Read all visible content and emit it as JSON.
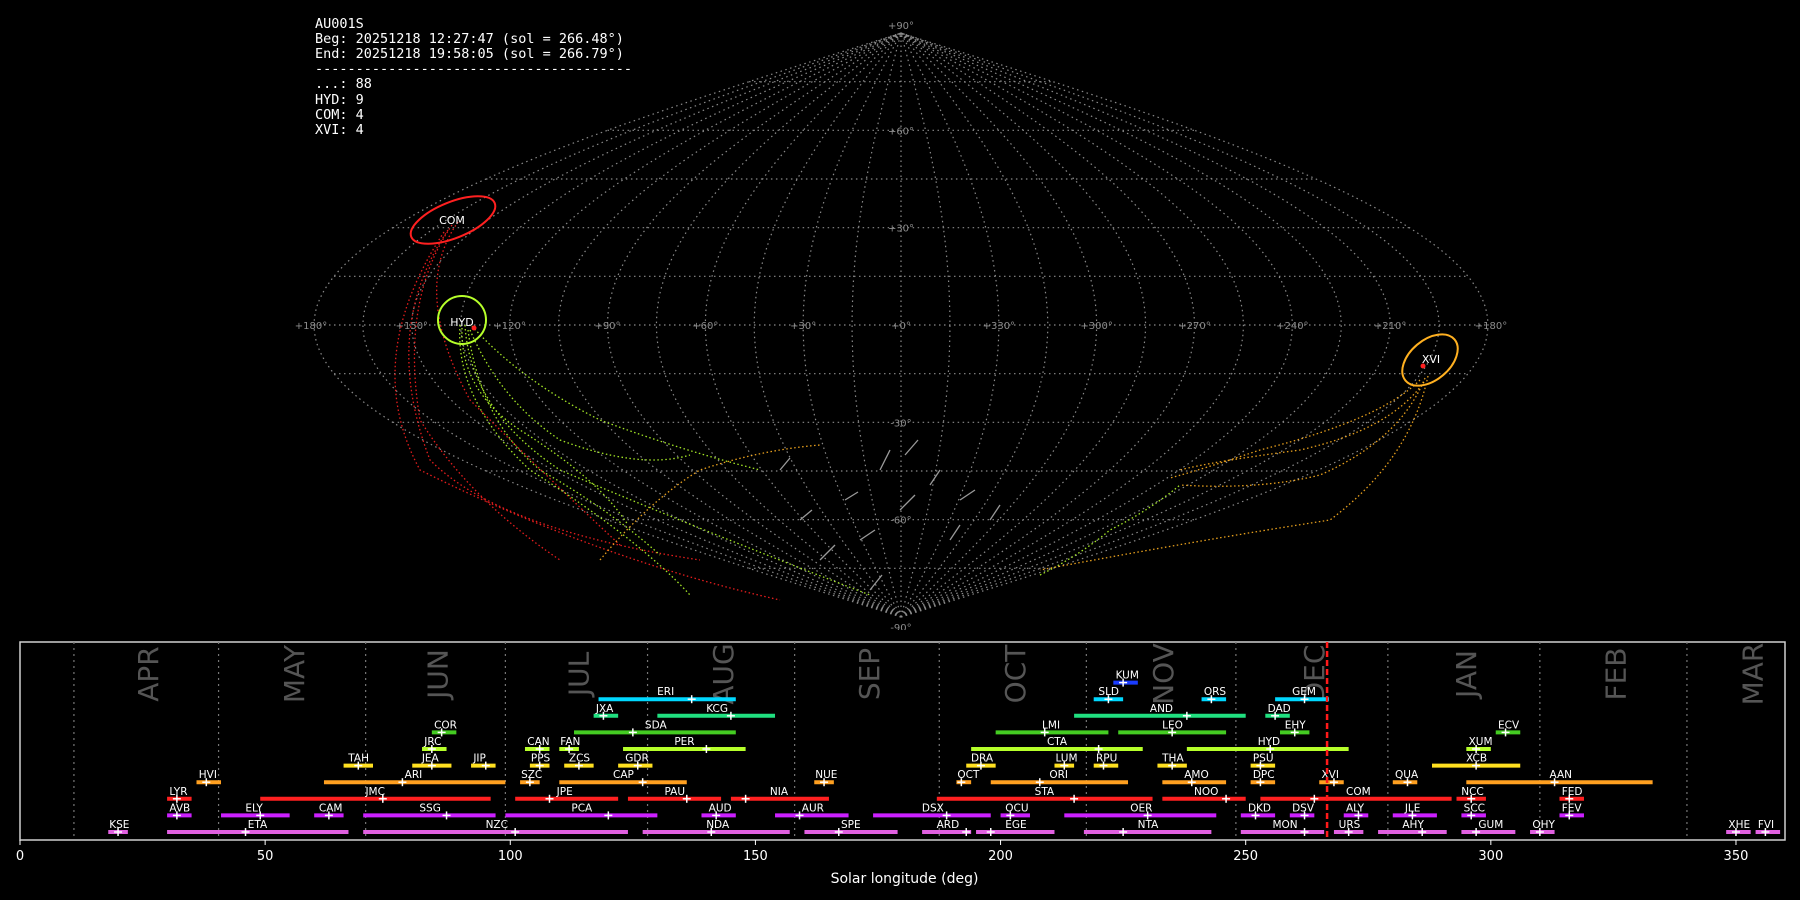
{
  "header": {
    "station": "AU001S",
    "begin": "Beg: 20251218 12:27:47 (sol = 266.48°)",
    "end": "End: 20251218 19:58:05 (sol = 266.79°)",
    "separator": "---------------------------------------",
    "counts": [
      {
        "label": "...: 88"
      },
      {
        "label": "HYD: 9"
      },
      {
        "label": "COM: 4"
      },
      {
        "label": "XVI: 4"
      }
    ]
  },
  "colors": {
    "background": "#000000",
    "grid": "#8a8a8a",
    "COM": "#ff2020",
    "HYD": "#b6ff2a",
    "XVI": "#ffb020",
    "sporadic": "#9a9a9a",
    "current_sol_line": "#ff1a1a"
  },
  "chart_data": [
    {
      "type": "map",
      "projection": "sinusoidal",
      "lon_ticks": [
        "+180°",
        "+150°",
        "+120°",
        "+90°",
        "+60°",
        "+30°",
        "+0°",
        "+330°",
        "+300°",
        "+270°",
        "+240°",
        "+210°",
        "+180°"
      ],
      "lat_ticks": [
        "+90°",
        "+60°",
        "+30°",
        "-30°",
        "-60°",
        "-90°"
      ],
      "radiants": [
        {
          "name": "COM",
          "lon": 150,
          "lat": 32,
          "color": "#ff2020"
        },
        {
          "name": "HYD",
          "lon": 130,
          "lat": 0,
          "color": "#b6ff2a"
        },
        {
          "name": "XVI",
          "lon": 200,
          "lat": -12,
          "color": "#ffb020"
        }
      ],
      "grid": true
    },
    {
      "type": "timeline",
      "xlabel": "Solar longitude (deg)",
      "xlim": [
        0,
        360
      ],
      "xticks": [
        0,
        50,
        100,
        150,
        200,
        250,
        300,
        350
      ],
      "current_sol": 266.6,
      "months": [
        {
          "label": "APR",
          "start": 11,
          "end": 40.5
        },
        {
          "label": "MAY",
          "start": 40.5,
          "end": 70.5
        },
        {
          "label": "JUN",
          "start": 70.5,
          "end": 99
        },
        {
          "label": "JUL",
          "start": 99,
          "end": 128
        },
        {
          "label": "AUG",
          "start": 128,
          "end": 158
        },
        {
          "label": "SEP",
          "start": 158,
          "end": 187.5
        },
        {
          "label": "OCT",
          "start": 187.5,
          "end": 217.5
        },
        {
          "label": "NOV",
          "start": 217.5,
          "end": 248
        },
        {
          "label": "DEC",
          "start": 248,
          "end": 279
        },
        {
          "label": "JAN",
          "start": 279,
          "end": 310
        },
        {
          "label": "FEB",
          "start": 310,
          "end": 340
        },
        {
          "label": "MAR",
          "start": 340,
          "end": 369
        }
      ],
      "showers": [
        {
          "name": "KUM",
          "start": 223,
          "end": 228,
          "peak": 225,
          "row": 10,
          "color": "#1a3cff"
        },
        {
          "name": "ERI",
          "start": 118,
          "end": 146,
          "peak": 137,
          "row": 9,
          "color": "#00d8ff"
        },
        {
          "name": "SLD",
          "start": 219,
          "end": 225,
          "peak": 222,
          "row": 9,
          "color": "#00d8ff"
        },
        {
          "name": "ORS",
          "start": 241,
          "end": 246,
          "peak": 243,
          "row": 9,
          "color": "#00d8ff"
        },
        {
          "name": "GEM",
          "start": 256,
          "end": 267,
          "peak": 262,
          "row": 9,
          "color": "#00d8ff"
        },
        {
          "name": "JXA",
          "start": 117,
          "end": 122,
          "peak": 119,
          "row": 8,
          "color": "#20e080"
        },
        {
          "name": "KCG",
          "start": 130,
          "end": 154,
          "peak": 145,
          "row": 8,
          "color": "#20e080"
        },
        {
          "name": "AND",
          "start": 215,
          "end": 250,
          "peak": 238,
          "row": 8,
          "color": "#20e080"
        },
        {
          "name": "DAD",
          "start": 254,
          "end": 259,
          "peak": 256,
          "row": 8,
          "color": "#20e080"
        },
        {
          "name": "COR",
          "start": 84,
          "end": 89,
          "peak": 86,
          "row": 7,
          "color": "#44cc22"
        },
        {
          "name": "SDA",
          "start": 113,
          "end": 146,
          "peak": 125,
          "row": 7,
          "color": "#44cc22"
        },
        {
          "name": "LMI",
          "start": 199,
          "end": 222,
          "peak": 209,
          "row": 7,
          "color": "#44cc22"
        },
        {
          "name": "LEO",
          "start": 224,
          "end": 246,
          "peak": 235,
          "row": 7,
          "color": "#44cc22"
        },
        {
          "name": "EHY",
          "start": 257,
          "end": 263,
          "peak": 260,
          "row": 7,
          "color": "#44cc22"
        },
        {
          "name": "ECV",
          "start": 301,
          "end": 306,
          "peak": 303,
          "row": 7,
          "color": "#44cc22"
        },
        {
          "name": "JRC",
          "start": 82,
          "end": 87,
          "peak": 84,
          "row": 6,
          "color": "#b6ff2a"
        },
        {
          "name": "CAN",
          "start": 103,
          "end": 108,
          "peak": 106,
          "row": 6,
          "color": "#b6ff2a"
        },
        {
          "name": "FAN",
          "start": 110,
          "end": 114,
          "peak": 112,
          "row": 6,
          "color": "#b6ff2a"
        },
        {
          "name": "PER",
          "start": 123,
          "end": 148,
          "peak": 140,
          "row": 6,
          "color": "#b6ff2a"
        },
        {
          "name": "CTA",
          "start": 194,
          "end": 229,
          "peak": 220,
          "row": 6,
          "color": "#b6ff2a"
        },
        {
          "name": "HYD",
          "start": 238,
          "end": 271,
          "peak": 255,
          "row": 6,
          "color": "#b6ff2a"
        },
        {
          "name": "XUM",
          "start": 295,
          "end": 300,
          "peak": 297,
          "row": 6,
          "color": "#b6ff2a"
        },
        {
          "name": "TAH",
          "start": 66,
          "end": 72,
          "peak": 69,
          "row": 5,
          "color": "#ffe020"
        },
        {
          "name": "JEA",
          "start": 80,
          "end": 88,
          "peak": 84,
          "row": 5,
          "color": "#ffe020"
        },
        {
          "name": "JIP",
          "start": 92,
          "end": 97,
          "peak": 95,
          "row": 5,
          "color": "#ffe020"
        },
        {
          "name": "PPS",
          "start": 104,
          "end": 108,
          "peak": 106,
          "row": 5,
          "color": "#ffe020"
        },
        {
          "name": "ZCS",
          "start": 111,
          "end": 117,
          "peak": 114,
          "row": 5,
          "color": "#ffe020"
        },
        {
          "name": "GDR",
          "start": 122,
          "end": 129,
          "peak": 126,
          "row": 5,
          "color": "#ffe020"
        },
        {
          "name": "DRA",
          "start": 193,
          "end": 199,
          "peak": 196,
          "row": 5,
          "color": "#ffe020"
        },
        {
          "name": "LUM",
          "start": 211,
          "end": 215,
          "peak": 213,
          "row": 5,
          "color": "#ffe020"
        },
        {
          "name": "RPU",
          "start": 219,
          "end": 224,
          "peak": 221,
          "row": 5,
          "color": "#ffe020"
        },
        {
          "name": "THA",
          "start": 232,
          "end": 238,
          "peak": 235,
          "row": 5,
          "color": "#ffe020"
        },
        {
          "name": "PSU",
          "start": 251,
          "end": 256,
          "peak": 253,
          "row": 5,
          "color": "#ffe020"
        },
        {
          "name": "XCB",
          "start": 288,
          "end": 306,
          "peak": 297,
          "row": 5,
          "color": "#ffe020"
        },
        {
          "name": "HVI",
          "start": 36,
          "end": 41,
          "peak": 38,
          "row": 4,
          "color": "#ffa020"
        },
        {
          "name": "ARI",
          "start": 62,
          "end": 99,
          "peak": 78,
          "row": 4,
          "color": "#ffa020"
        },
        {
          "name": "SZC",
          "start": 102,
          "end": 106,
          "peak": 104,
          "row": 4,
          "color": "#ffa020"
        },
        {
          "name": "CAP",
          "start": 110,
          "end": 136,
          "peak": 127,
          "row": 4,
          "color": "#ffa020"
        },
        {
          "name": "NUE",
          "start": 162,
          "end": 166,
          "peak": 164,
          "row": 4,
          "color": "#ffa020"
        },
        {
          "name": "OCT",
          "start": 191,
          "end": 194,
          "peak": 192,
          "row": 4,
          "color": "#ffa020"
        },
        {
          "name": "ORI",
          "start": 198,
          "end": 226,
          "peak": 208,
          "row": 4,
          "color": "#ffa020"
        },
        {
          "name": "AMO",
          "start": 233,
          "end": 246,
          "peak": 239,
          "row": 4,
          "color": "#ffa020"
        },
        {
          "name": "DPC",
          "start": 251,
          "end": 256,
          "peak": 253,
          "row": 4,
          "color": "#ffa020"
        },
        {
          "name": "XVI",
          "start": 265,
          "end": 270,
          "peak": 268,
          "row": 4,
          "color": "#ffa020"
        },
        {
          "name": "QUA",
          "start": 280,
          "end": 285,
          "peak": 283,
          "row": 4,
          "color": "#ffa020"
        },
        {
          "name": "AAN",
          "start": 295,
          "end": 333,
          "peak": 313,
          "row": 4,
          "color": "#ffa020"
        },
        {
          "name": "LYR",
          "start": 30,
          "end": 35,
          "peak": 32,
          "row": 3,
          "color": "#ff2020"
        },
        {
          "name": "JMC",
          "start": 49,
          "end": 96,
          "peak": 74,
          "row": 3,
          "color": "#ff2020"
        },
        {
          "name": "JPE",
          "start": 101,
          "end": 122,
          "peak": 108,
          "row": 3,
          "color": "#ff2020"
        },
        {
          "name": "PAU",
          "start": 124,
          "end": 143,
          "peak": 136,
          "row": 3,
          "color": "#ff2020"
        },
        {
          "name": "NIA",
          "start": 145,
          "end": 165,
          "peak": 148,
          "row": 3,
          "color": "#ff2020"
        },
        {
          "name": "STA",
          "start": 187,
          "end": 231,
          "peak": 215,
          "row": 3,
          "color": "#ff2020"
        },
        {
          "name": "NOO",
          "start": 233,
          "end": 250,
          "peak": 246,
          "row": 3,
          "color": "#ff2020"
        },
        {
          "name": "COM",
          "start": 253,
          "end": 292,
          "peak": 264,
          "row": 3,
          "color": "#ff2020"
        },
        {
          "name": "NCC",
          "start": 293,
          "end": 299,
          "peak": 296,
          "row": 3,
          "color": "#ff2020"
        },
        {
          "name": "FED",
          "start": 314,
          "end": 319,
          "peak": 316,
          "row": 3,
          "color": "#ff2020"
        },
        {
          "name": "AVB",
          "start": 30,
          "end": 35,
          "peak": 32,
          "row": 2,
          "color": "#cc20ff"
        },
        {
          "name": "ELY",
          "start": 41,
          "end": 55,
          "peak": 49,
          "row": 2,
          "color": "#cc20ff"
        },
        {
          "name": "CAM",
          "start": 60,
          "end": 66,
          "peak": 63,
          "row": 2,
          "color": "#cc20ff"
        },
        {
          "name": "SSG",
          "start": 70,
          "end": 97,
          "peak": 87,
          "row": 2,
          "color": "#cc20ff"
        },
        {
          "name": "PCA",
          "start": 99,
          "end": 130,
          "peak": 120,
          "row": 2,
          "color": "#cc20ff"
        },
        {
          "name": "AUD",
          "start": 139,
          "end": 146,
          "peak": 142,
          "row": 2,
          "color": "#cc20ff"
        },
        {
          "name": "AUR",
          "start": 154,
          "end": 169,
          "peak": 159,
          "row": 2,
          "color": "#cc20ff"
        },
        {
          "name": "DSX",
          "start": 174,
          "end": 198,
          "peak": 189,
          "row": 2,
          "color": "#cc20ff"
        },
        {
          "name": "OCU",
          "start": 200,
          "end": 206,
          "peak": 202,
          "row": 2,
          "color": "#cc20ff"
        },
        {
          "name": "OER",
          "start": 213,
          "end": 244,
          "peak": 230,
          "row": 2,
          "color": "#cc20ff"
        },
        {
          "name": "DKD",
          "start": 249,
          "end": 256,
          "peak": 252,
          "row": 2,
          "color": "#cc20ff"
        },
        {
          "name": "DSV",
          "start": 259,
          "end": 264,
          "peak": 262,
          "row": 2,
          "color": "#cc20ff"
        },
        {
          "name": "ALY",
          "start": 270,
          "end": 275,
          "peak": 273,
          "row": 2,
          "color": "#cc20ff"
        },
        {
          "name": "JLE",
          "start": 280,
          "end": 289,
          "peak": 284,
          "row": 2,
          "color": "#cc20ff"
        },
        {
          "name": "SCC",
          "start": 294,
          "end": 299,
          "peak": 296,
          "row": 2,
          "color": "#cc20ff"
        },
        {
          "name": "FEV",
          "start": 314,
          "end": 319,
          "peak": 316,
          "row": 2,
          "color": "#cc20ff"
        },
        {
          "name": "KSE",
          "start": 18,
          "end": 22,
          "peak": 20,
          "row": 1,
          "color": "#e060e0"
        },
        {
          "name": "ETA",
          "start": 30,
          "end": 67,
          "peak": 46,
          "row": 1,
          "color": "#e060e0"
        },
        {
          "name": "NZC",
          "start": 70,
          "end": 124,
          "peak": 101,
          "row": 1,
          "color": "#e060e0"
        },
        {
          "name": "NDA",
          "start": 127,
          "end": 157,
          "peak": 141,
          "row": 1,
          "color": "#e060e0"
        },
        {
          "name": "SPE",
          "start": 160,
          "end": 179,
          "peak": 167,
          "row": 1,
          "color": "#e060e0"
        },
        {
          "name": "ARD",
          "start": 184,
          "end": 194,
          "peak": 193,
          "row": 1,
          "color": "#e060e0"
        },
        {
          "name": "EGE",
          "start": 195,
          "end": 211,
          "peak": 198,
          "row": 1,
          "color": "#e060e0"
        },
        {
          "name": "NTA",
          "start": 217,
          "end": 243,
          "peak": 225,
          "row": 1,
          "color": "#e060e0"
        },
        {
          "name": "MON",
          "start": 249,
          "end": 266,
          "peak": 262,
          "row": 1,
          "color": "#e060e0"
        },
        {
          "name": "URS",
          "start": 268,
          "end": 274,
          "peak": 271,
          "row": 1,
          "color": "#e060e0"
        },
        {
          "name": "AHY",
          "start": 277,
          "end": 291,
          "peak": 286,
          "row": 1,
          "color": "#e060e0"
        },
        {
          "name": "GUM",
          "start": 294,
          "end": 305,
          "peak": 297,
          "row": 1,
          "color": "#e060e0"
        },
        {
          "name": "OHY",
          "start": 308,
          "end": 313,
          "peak": 310,
          "row": 1,
          "color": "#e060e0"
        },
        {
          "name": "XHE",
          "start": 348,
          "end": 353,
          "peak": 350,
          "row": 1,
          "color": "#e060e0"
        },
        {
          "name": "FVI",
          "start": 354,
          "end": 359,
          "peak": 356,
          "row": 1,
          "color": "#e060e0"
        }
      ]
    }
  ]
}
